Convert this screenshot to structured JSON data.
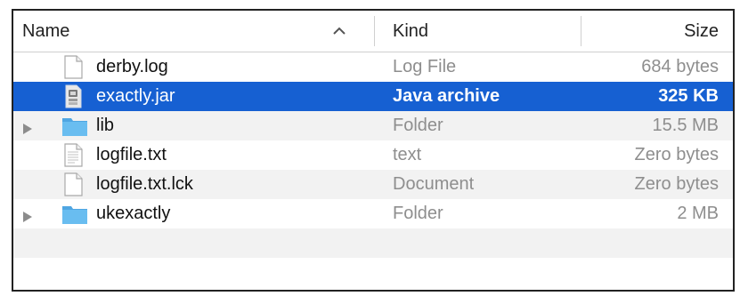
{
  "columns": {
    "name": "Name",
    "kind": "Kind",
    "size": "Size",
    "sort_indicator": "chevron-up-icon"
  },
  "files": [
    {
      "name": "derby.log",
      "kind": "Log File",
      "size": "684 bytes",
      "icon": "document-icon",
      "expandable": false,
      "selected": false
    },
    {
      "name": "exactly.jar",
      "kind": "Java archive",
      "size": "325 KB",
      "icon": "java-archive-icon",
      "expandable": false,
      "selected": true
    },
    {
      "name": "lib",
      "kind": "Folder",
      "size": "15.5 MB",
      "icon": "folder-icon",
      "expandable": true,
      "selected": false
    },
    {
      "name": "logfile.txt",
      "kind": "text",
      "size": "Zero bytes",
      "icon": "text-document-icon",
      "expandable": false,
      "selected": false
    },
    {
      "name": "logfile.txt.lck",
      "kind": "Document",
      "size": "Zero bytes",
      "icon": "document-icon",
      "expandable": false,
      "selected": false
    },
    {
      "name": "ukexactly",
      "kind": "Folder",
      "size": "2 MB",
      "icon": "folder-icon",
      "expandable": true,
      "selected": false
    }
  ],
  "colors": {
    "selection": "#1660d2",
    "alt_row": "#f2f2f2",
    "folder": "#63b6ec"
  }
}
